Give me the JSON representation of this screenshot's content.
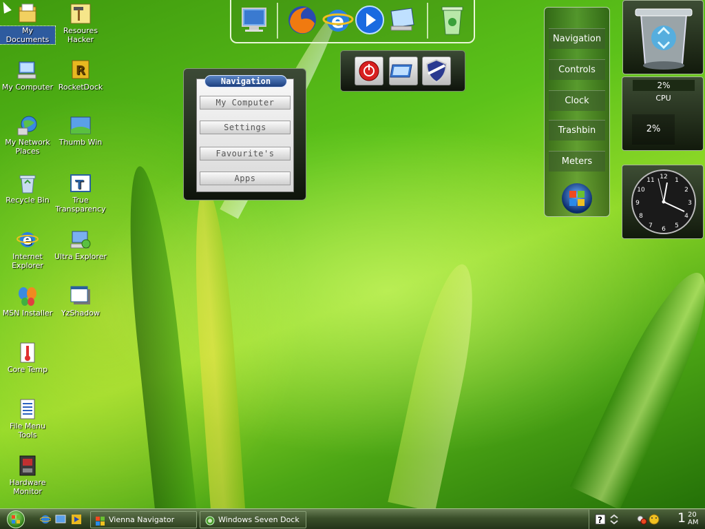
{
  "desktop_icons": [
    {
      "label": "My Documents",
      "icon": "folder-documents-icon"
    },
    {
      "label": "Resoures Hacker",
      "icon": "hammer-tool-icon"
    },
    {
      "label": "My Computer",
      "icon": "computer-icon"
    },
    {
      "label": "RocketDock",
      "icon": "rocketdock-icon"
    },
    {
      "label": "My Network Places",
      "icon": "network-globe-icon"
    },
    {
      "label": "Thumb Win",
      "icon": "thumbnail-window-icon"
    },
    {
      "label": "Recycle Bin",
      "icon": "recycle-bin-icon"
    },
    {
      "label": "True Transparency",
      "icon": "transparency-window-icon"
    },
    {
      "label": "Internet Explorer",
      "icon": "internet-explorer-icon"
    },
    {
      "label": "Ultra Explorer",
      "icon": "ultra-explorer-icon"
    },
    {
      "label": "MSN Installer",
      "icon": "msn-butterfly-icon"
    },
    {
      "label": "YzShadow",
      "icon": "shadow-window-icon"
    },
    {
      "label": "Core Temp",
      "icon": "thermometer-icon"
    },
    {
      "label": "File Menu Tools",
      "icon": "file-menu-icon"
    },
    {
      "label": "Hardware Monitor",
      "icon": "hardware-chip-icon"
    }
  ],
  "navigation_panel": {
    "title": "Navigation",
    "buttons": [
      "My Computer",
      "Settings",
      "Favourite's",
      "Apps"
    ]
  },
  "side_panel": {
    "items": [
      "Navigation",
      "Controls",
      "Clock",
      "Trashbin",
      "Meters"
    ]
  },
  "cpu_meter": {
    "top_value": "2%",
    "label": "CPU",
    "box_value": "2%"
  },
  "clock_widget": {
    "numbers": [
      "12",
      "1",
      "2",
      "3",
      "4",
      "5",
      "6",
      "7",
      "8",
      "9",
      "10",
      "11"
    ]
  },
  "taskbar": {
    "buttons": [
      "Vienna Navigator",
      "Windows Seven Dock"
    ],
    "time_hour": "1",
    "time_min": "20",
    "time_ampm": "AM"
  },
  "colors": {
    "accent_blue": "#2e5b9f",
    "panel_dark": "#121a0c",
    "grass_green": "#5cc21a"
  }
}
